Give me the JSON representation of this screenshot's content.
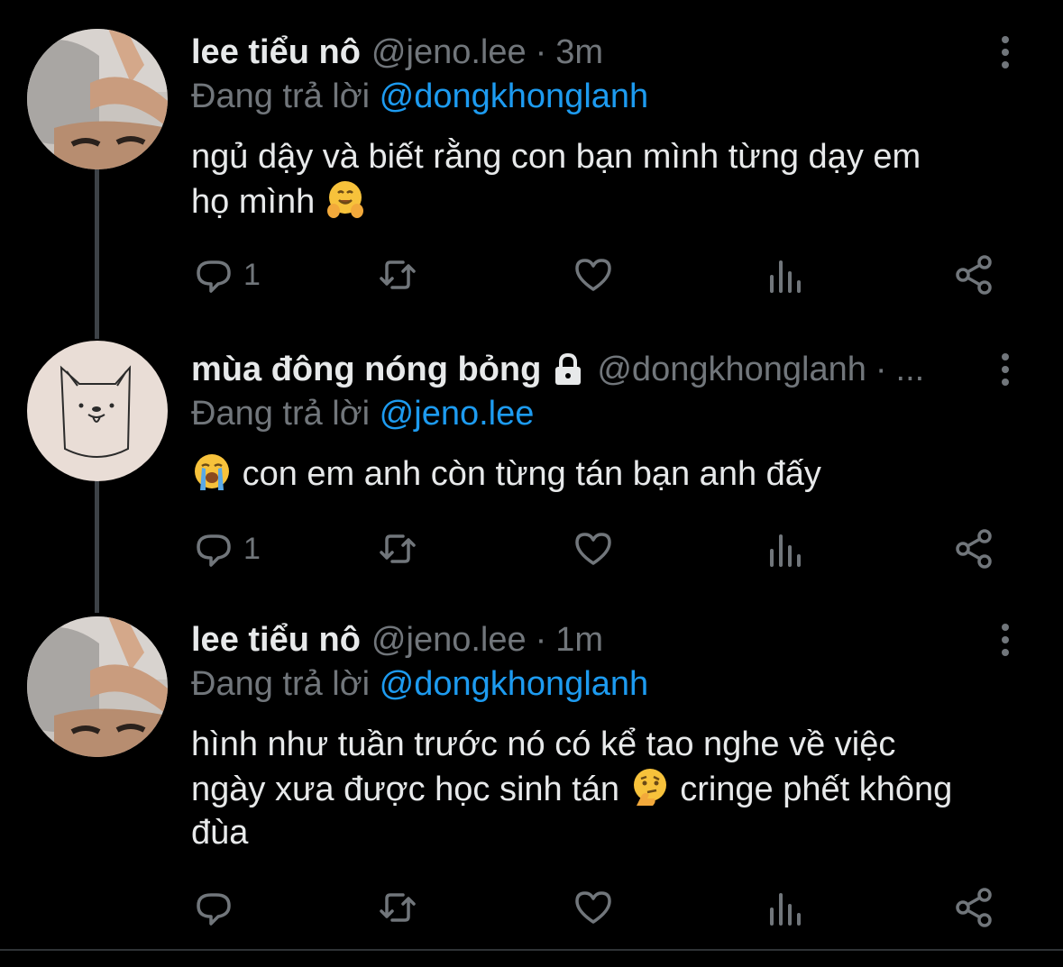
{
  "colors": {
    "background": "#000000",
    "text_primary": "#e7e9ea",
    "text_secondary": "#71767b",
    "link": "#1d9bf0",
    "thread_line": "#3d4247"
  },
  "tweets": [
    {
      "display_name": "lee tiểu nô",
      "handle": "@jeno.lee",
      "dot": "·",
      "time": "3m",
      "reply_prefix": "Đang trả lời",
      "reply_target": "@dongkhonglanh",
      "text_line1": "ngủ dậy và biết rằng con bạn mình từng dạy em",
      "text_line2": "họ mình",
      "emoji": "hugging-face-emoji",
      "reply_count": "1",
      "avatar": "photo-avatar"
    },
    {
      "display_name": "mùa đông nóng bỏng",
      "locked": true,
      "handle": "@dongkhonglanh",
      "dot": "·",
      "time": "...",
      "reply_prefix": "Đang trả lời",
      "reply_target": "@jeno.lee",
      "emoji": "loudly-crying-face-emoji",
      "text_line1": "con em anh còn từng tán bạn anh đấy",
      "reply_count": "1",
      "avatar": "dog-drawing-avatar"
    },
    {
      "display_name": "lee tiểu nô",
      "handle": "@jeno.lee",
      "dot": "·",
      "time": "1m",
      "reply_prefix": "Đang trả lời",
      "reply_target": "@dongkhonglanh",
      "text_line1": "hình như tuần trước nó có kể tao nghe về việc",
      "text_line2a": "ngày xưa được học sinh tán",
      "emoji": "thinking-face-emoji",
      "text_line2b": "cringe phết không",
      "text_line3": "đùa",
      "reply_count": "",
      "avatar": "photo-avatar"
    }
  ],
  "icons": {
    "reply": "reply-icon",
    "retweet": "retweet-icon",
    "like": "heart-icon",
    "analytics": "analytics-icon",
    "share": "share-icon",
    "more": "more-options-icon",
    "lock": "lock-icon"
  }
}
